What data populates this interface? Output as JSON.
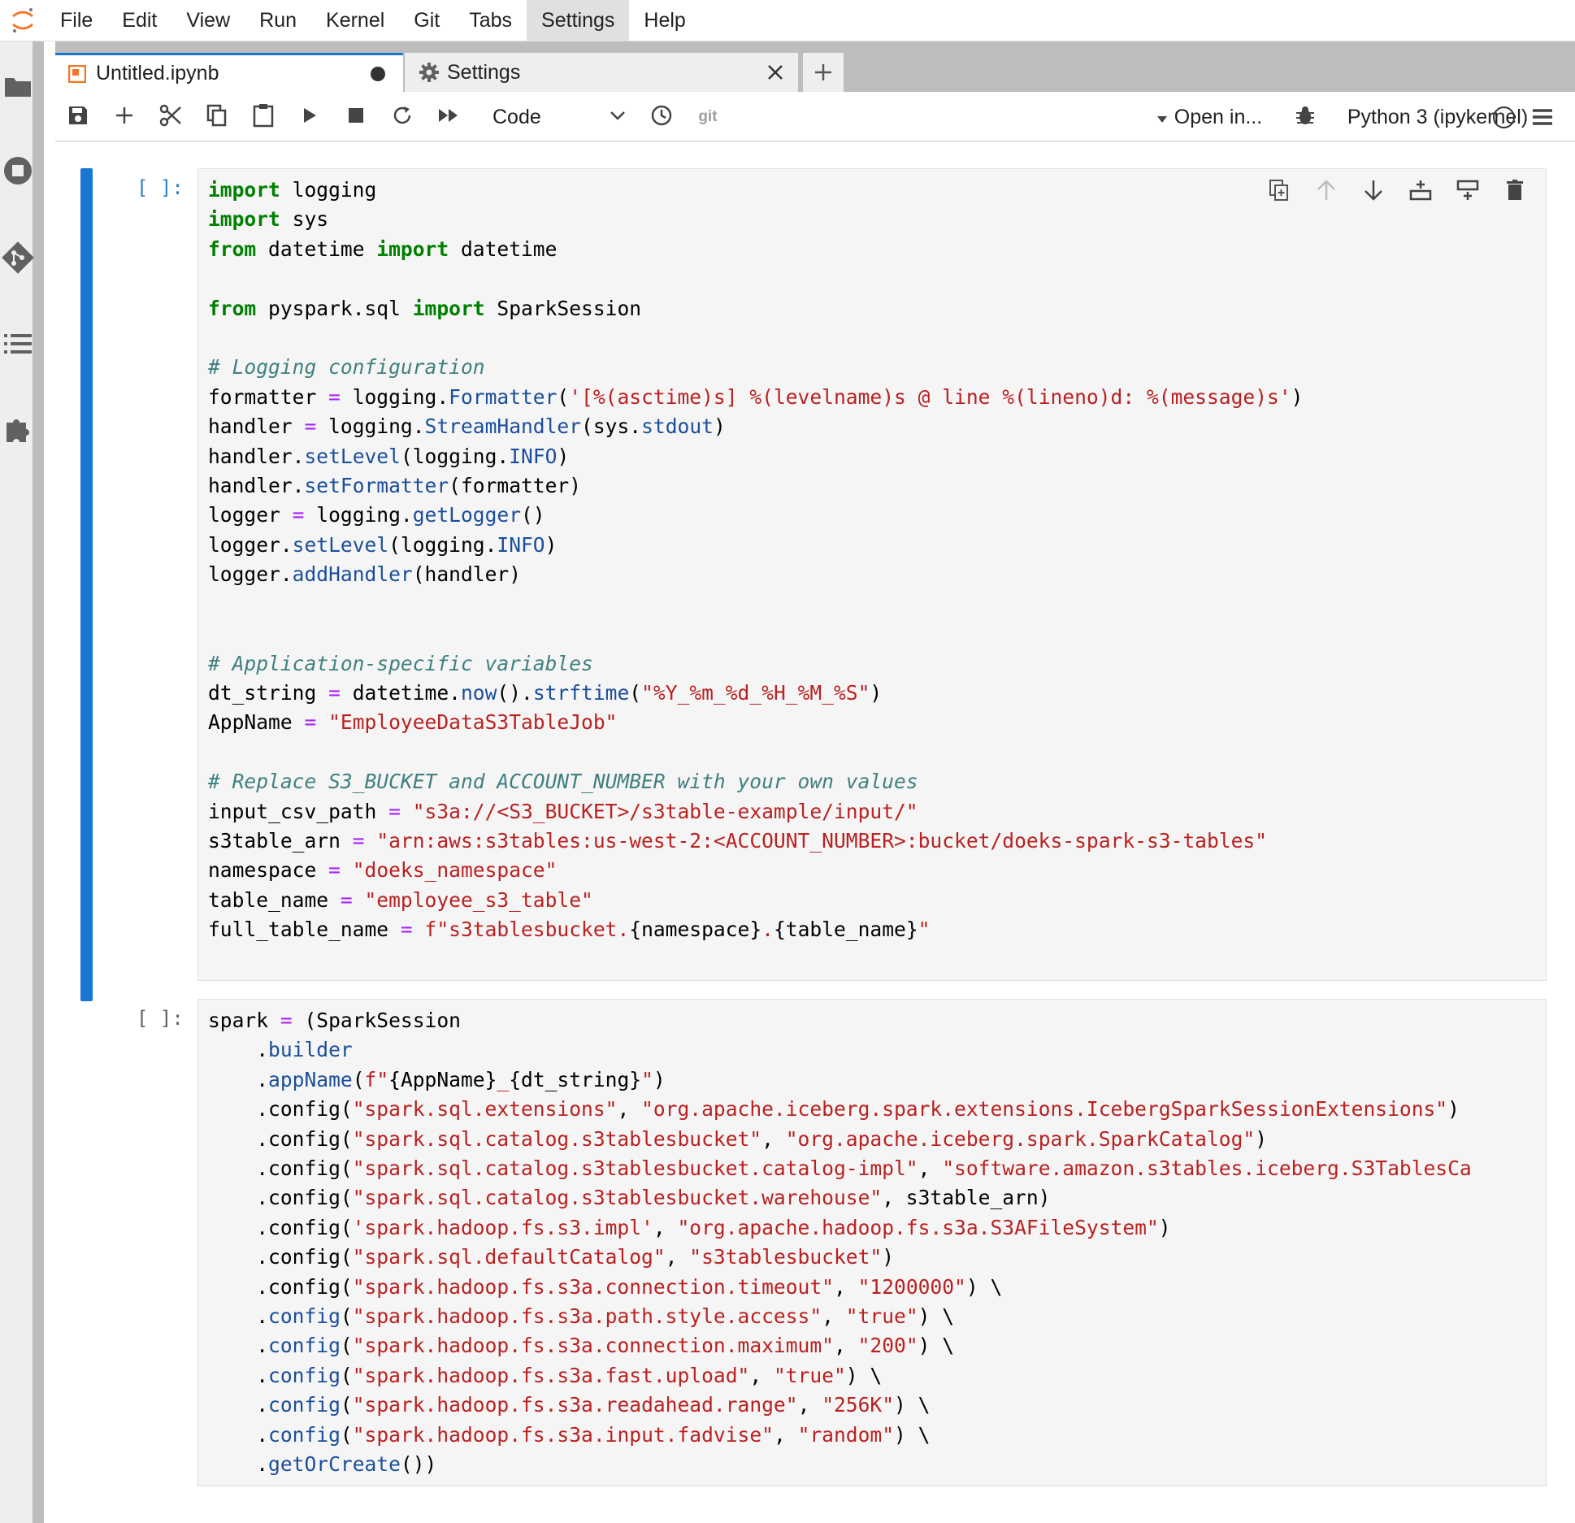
{
  "menubar": {
    "items": [
      "File",
      "Edit",
      "View",
      "Run",
      "Kernel",
      "Git",
      "Tabs",
      "Settings",
      "Help"
    ],
    "active": "Settings"
  },
  "tabs": [
    {
      "label": "Untitled.ipynb",
      "icon": "notebook-icon",
      "dirty": true
    },
    {
      "label": "Settings",
      "icon": "gear-icon"
    }
  ],
  "toolbar": {
    "cell_type": "Code",
    "git_label": "git",
    "open_in_label": "Open in...",
    "kernel_name": "Python 3 (ipykernel)"
  },
  "cells": [
    {
      "prompt": "[ ]:",
      "active": true,
      "lines": [
        [
          [
            "k",
            "import"
          ],
          [
            "n",
            " logging"
          ]
        ],
        [
          [
            "k",
            "import"
          ],
          [
            "n",
            " sys"
          ]
        ],
        [
          [
            "k",
            "from"
          ],
          [
            "n",
            " datetime "
          ],
          [
            "k",
            "import"
          ],
          [
            "n",
            " datetime"
          ]
        ],
        [],
        [
          [
            "k",
            "from"
          ],
          [
            "n",
            " pyspark.sql "
          ],
          [
            "k",
            "import"
          ],
          [
            "n",
            " SparkSession"
          ]
        ],
        [],
        [
          [
            "c",
            "# Logging configuration"
          ]
        ],
        [
          [
            "n",
            "formatter "
          ],
          [
            "o",
            "="
          ],
          [
            "n",
            " logging."
          ],
          [
            "f",
            "Formatter"
          ],
          [
            "n",
            "("
          ],
          [
            "s",
            "'[%(asctime)s] %(levelname)s @ line %(lineno)d: %(message)s'"
          ],
          [
            "n",
            ")"
          ]
        ],
        [
          [
            "n",
            "handler "
          ],
          [
            "o",
            "="
          ],
          [
            "n",
            " logging."
          ],
          [
            "f",
            "StreamHandler"
          ],
          [
            "n",
            "(sys."
          ],
          [
            "f",
            "stdout"
          ],
          [
            "n",
            ")"
          ]
        ],
        [
          [
            "n",
            "handler."
          ],
          [
            "f",
            "setLevel"
          ],
          [
            "n",
            "(logging."
          ],
          [
            "f",
            "INFO"
          ],
          [
            "n",
            ")"
          ]
        ],
        [
          [
            "n",
            "handler."
          ],
          [
            "f",
            "setFormatter"
          ],
          [
            "n",
            "(formatter)"
          ]
        ],
        [
          [
            "n",
            "logger "
          ],
          [
            "o",
            "="
          ],
          [
            "n",
            " logging."
          ],
          [
            "f",
            "getLogger"
          ],
          [
            "n",
            "()"
          ]
        ],
        [
          [
            "n",
            "logger."
          ],
          [
            "f",
            "setLevel"
          ],
          [
            "n",
            "(logging."
          ],
          [
            "f",
            "INFO"
          ],
          [
            "n",
            ")"
          ]
        ],
        [
          [
            "n",
            "logger."
          ],
          [
            "f",
            "addHandler"
          ],
          [
            "n",
            "(handler)"
          ]
        ],
        [],
        [],
        [
          [
            "c",
            "# Application-specific variables"
          ]
        ],
        [
          [
            "n",
            "dt_string "
          ],
          [
            "o",
            "="
          ],
          [
            "n",
            " datetime."
          ],
          [
            "f",
            "now"
          ],
          [
            "n",
            "()."
          ],
          [
            "f",
            "strftime"
          ],
          [
            "n",
            "("
          ],
          [
            "s",
            "\"%Y_%m_%d_%H_%M_%S\""
          ],
          [
            "n",
            ")"
          ]
        ],
        [
          [
            "n",
            "AppName "
          ],
          [
            "o",
            "="
          ],
          [
            "n",
            " "
          ],
          [
            "s",
            "\"EmployeeDataS3TableJob\""
          ]
        ],
        [],
        [
          [
            "c",
            "# Replace S3_BUCKET and ACCOUNT_NUMBER with your own values"
          ]
        ],
        [
          [
            "n",
            "input_csv_path "
          ],
          [
            "o",
            "="
          ],
          [
            "n",
            " "
          ],
          [
            "s",
            "\"s3a://<S3_BUCKET>/s3table-example/input/\""
          ]
        ],
        [
          [
            "n",
            "s3table_arn "
          ],
          [
            "o",
            "="
          ],
          [
            "n",
            " "
          ],
          [
            "s",
            "\"arn:aws:s3tables:us-west-2:<ACCOUNT_NUMBER>:bucket/doeks-spark-s3-tables\""
          ]
        ],
        [
          [
            "n",
            "namespace "
          ],
          [
            "o",
            "="
          ],
          [
            "n",
            " "
          ],
          [
            "s",
            "\"doeks_namespace\""
          ]
        ],
        [
          [
            "n",
            "table_name "
          ],
          [
            "o",
            "="
          ],
          [
            "n",
            " "
          ],
          [
            "s",
            "\"employee_s3_table\""
          ]
        ],
        [
          [
            "n",
            "full_table_name "
          ],
          [
            "o",
            "="
          ],
          [
            "n",
            " "
          ],
          [
            "s",
            "f\"s3tablesbucket."
          ],
          [
            "n",
            "{namespace}"
          ],
          [
            "s",
            "."
          ],
          [
            "n",
            "{table_name}"
          ],
          [
            "s",
            "\""
          ]
        ]
      ]
    },
    {
      "prompt": "[ ]:",
      "active": false,
      "lines": [
        [
          [
            "n",
            "spark "
          ],
          [
            "o",
            "="
          ],
          [
            "n",
            " (SparkSession"
          ]
        ],
        [
          [
            "n",
            "    ."
          ],
          [
            "f",
            "builder"
          ]
        ],
        [
          [
            "n",
            "    ."
          ],
          [
            "f",
            "appName"
          ],
          [
            "n",
            "("
          ],
          [
            "s",
            "f\""
          ],
          [
            "n",
            "{AppName}"
          ],
          [
            "s",
            "_"
          ],
          [
            "n",
            "{dt_string}"
          ],
          [
            "s",
            "\""
          ],
          [
            "n",
            ")"
          ]
        ],
        [
          [
            "n",
            "    .config("
          ],
          [
            "s",
            "\"spark.sql.extensions\""
          ],
          [
            "n",
            ", "
          ],
          [
            "s",
            "\"org.apache.iceberg.spark.extensions.IcebergSparkSessionExtensions\""
          ],
          [
            "n",
            ")"
          ]
        ],
        [
          [
            "n",
            "    .config("
          ],
          [
            "s",
            "\"spark.sql.catalog.s3tablesbucket\""
          ],
          [
            "n",
            ", "
          ],
          [
            "s",
            "\"org.apache.iceberg.spark.SparkCatalog\""
          ],
          [
            "n",
            ")"
          ]
        ],
        [
          [
            "n",
            "    .config("
          ],
          [
            "s",
            "\"spark.sql.catalog.s3tablesbucket.catalog-impl\""
          ],
          [
            "n",
            ", "
          ],
          [
            "s",
            "\"software.amazon.s3tables.iceberg.S3TablesCa"
          ]
        ],
        [
          [
            "n",
            "    .config("
          ],
          [
            "s",
            "\"spark.sql.catalog.s3tablesbucket.warehouse\""
          ],
          [
            "n",
            ", s3table_arn)"
          ]
        ],
        [
          [
            "n",
            "    .config("
          ],
          [
            "s",
            "'spark.hadoop.fs.s3.impl'"
          ],
          [
            "n",
            ", "
          ],
          [
            "s",
            "\"org.apache.hadoop.fs.s3a.S3AFileSystem\""
          ],
          [
            "n",
            ")"
          ]
        ],
        [
          [
            "n",
            "    .config("
          ],
          [
            "s",
            "\"spark.sql.defaultCatalog\""
          ],
          [
            "n",
            ", "
          ],
          [
            "s",
            "\"s3tablesbucket\""
          ],
          [
            "n",
            ")"
          ]
        ],
        [
          [
            "n",
            "    .config("
          ],
          [
            "s",
            "\"spark.hadoop.fs.s3a.connection.timeout\""
          ],
          [
            "n",
            ", "
          ],
          [
            "s",
            "\"1200000\""
          ],
          [
            "n",
            ") \\"
          ]
        ],
        [
          [
            "n",
            "    ."
          ],
          [
            "f",
            "config"
          ],
          [
            "n",
            "("
          ],
          [
            "s",
            "\"spark.hadoop.fs.s3a.path.style.access\""
          ],
          [
            "n",
            ", "
          ],
          [
            "s",
            "\"true\""
          ],
          [
            "n",
            ") \\"
          ]
        ],
        [
          [
            "n",
            "    ."
          ],
          [
            "f",
            "config"
          ],
          [
            "n",
            "("
          ],
          [
            "s",
            "\"spark.hadoop.fs.s3a.connection.maximum\""
          ],
          [
            "n",
            ", "
          ],
          [
            "s",
            "\"200\""
          ],
          [
            "n",
            ") \\"
          ]
        ],
        [
          [
            "n",
            "    ."
          ],
          [
            "f",
            "config"
          ],
          [
            "n",
            "("
          ],
          [
            "s",
            "\"spark.hadoop.fs.s3a.fast.upload\""
          ],
          [
            "n",
            ", "
          ],
          [
            "s",
            "\"true\""
          ],
          [
            "n",
            ") \\"
          ]
        ],
        [
          [
            "n",
            "    ."
          ],
          [
            "f",
            "config"
          ],
          [
            "n",
            "("
          ],
          [
            "s",
            "\"spark.hadoop.fs.s3a.readahead.range\""
          ],
          [
            "n",
            ", "
          ],
          [
            "s",
            "\"256K\""
          ],
          [
            "n",
            ") \\"
          ]
        ],
        [
          [
            "n",
            "    ."
          ],
          [
            "f",
            "config"
          ],
          [
            "n",
            "("
          ],
          [
            "s",
            "\"spark.hadoop.fs.s3a.input.fadvise\""
          ],
          [
            "n",
            ", "
          ],
          [
            "s",
            "\"random\""
          ],
          [
            "n",
            ") \\"
          ]
        ],
        [
          [
            "n",
            "    ."
          ],
          [
            "f",
            "getOrCreate"
          ],
          [
            "n",
            "())"
          ]
        ]
      ]
    }
  ]
}
